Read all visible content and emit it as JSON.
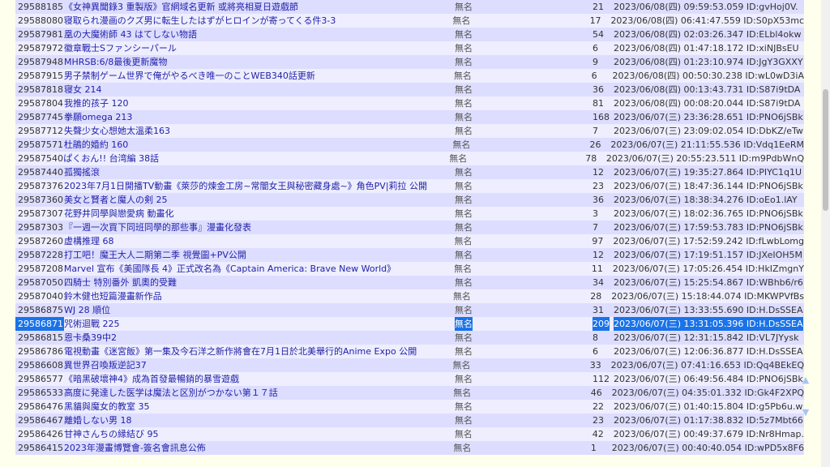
{
  "rows": [
    {
      "id": "29588185",
      "title": "《女神異聞錄3 重製版》官網域名更新 或將亮相夏日遊戲節",
      "author": "無名",
      "replies": "21",
      "time": "2023/06/08(四) 09:59:53.059 ID:gvHoj0V."
    },
    {
      "id": "29588080",
      "title": "寝取られ漫画のクズ男に転生したはずがヒロインが寄ってくる件3-3",
      "author": "無名",
      "replies": "17",
      "time": "2023/06/08(四) 06:41:47.559 ID:S0pX53mc"
    },
    {
      "id": "29587981",
      "title": "凰の大魔術師 43 はてしない物語",
      "author": "無名",
      "replies": "54",
      "time": "2023/06/08(四) 02:03:26.347 ID:ELbl4okw"
    },
    {
      "id": "29587972",
      "title": "徽章戰士Sファンシーパール",
      "author": "無名",
      "replies": "6",
      "time": "2023/06/08(四) 01:47:18.172 ID:xiNJBsEU"
    },
    {
      "id": "29587948",
      "title": "MHRSB:6/8最後更新魔物",
      "author": "無名",
      "replies": "9",
      "time": "2023/06/08(四) 01:23:10.974 ID:JgY3GXXY"
    },
    {
      "id": "29587915",
      "title": "男子禁制ゲーム世界で俺がやるべき唯一のことWEB340話更新",
      "author": "無名",
      "replies": "6",
      "time": "2023/06/08(四) 00:50:30.238 ID:wL0wD3iA"
    },
    {
      "id": "29587818",
      "title": "寝女 214",
      "author": "無名",
      "replies": "36",
      "time": "2023/06/08(四) 00:13:43.731 ID:S87i9tDA"
    },
    {
      "id": "29587804",
      "title": "我推的孩子 120",
      "author": "無名",
      "replies": "81",
      "time": "2023/06/08(四) 00:08:20.044 ID:S87i9tDA"
    },
    {
      "id": "29587745",
      "title": "拳願omega 213",
      "author": "無名",
      "replies": "168",
      "time": "2023/06/07(三) 23:36:28.651 ID:PNO6jSBk"
    },
    {
      "id": "29587712",
      "title": "失聲少女心想她太溫柔163",
      "author": "無名",
      "replies": "7",
      "time": "2023/06/07(三) 23:09:02.054 ID:DbKZ/eTw"
    },
    {
      "id": "29587571",
      "title": "杜鵑的婚約 160",
      "author": "無名",
      "replies": "26",
      "time": "2023/06/07(三) 21:11:55.536 ID:Vdq1EeRM"
    },
    {
      "id": "29587540",
      "title": "ぱくおん!! 台湾編 38話",
      "author": "無名",
      "replies": "78",
      "time": "2023/06/07(三) 20:55:23.511 ID:m9PdbWnQ"
    },
    {
      "id": "29587440",
      "title": "孤獨搖滾",
      "author": "無名",
      "replies": "12",
      "time": "2023/06/07(三) 19:35:27.864 ID:PIYC1q1U"
    },
    {
      "id": "29587376",
      "title": "2023年7月1日開播TV動畫《萊莎的煉金工房~常闇女王與秘密藏身處~》角色PV|莉拉 公開",
      "author": "無名",
      "replies": "23",
      "time": "2023/06/07(三) 18:47:36.144 ID:PNO6jSBk"
    },
    {
      "id": "29587360",
      "title": "美女と賢者と魔人の剣 25",
      "author": "無名",
      "replies": "36",
      "time": "2023/06/07(三) 18:38:34.276 ID:oEo1.lAY"
    },
    {
      "id": "29587307",
      "title": "花野井同學與戀愛病 動畫化",
      "author": "無名",
      "replies": "3",
      "time": "2023/06/07(三) 18:02:36.765 ID:PNO6jSBk"
    },
    {
      "id": "29587303",
      "title": "『一週一次買下同班同學的那些事』漫畫化發表",
      "author": "無名",
      "replies": "7",
      "time": "2023/06/07(三) 17:59:53.783 ID:PNO6jSBk"
    },
    {
      "id": "29587260",
      "title": "虚構推理 68",
      "author": "無名",
      "replies": "97",
      "time": "2023/06/07(三) 17:52:59.242 ID:fLwbLomg"
    },
    {
      "id": "29587228",
      "title": "打工吧！魔王大人二期第二季 視覺圖+PV公開",
      "author": "無名",
      "replies": "12",
      "time": "2023/06/07(三) 17:19:51.157 ID:JXeIOH5M"
    },
    {
      "id": "29587208",
      "title": "Marvel 宣布《美國隊長 4》正式改名為《Captain America: Brave New World》",
      "author": "無名",
      "replies": "11",
      "time": "2023/06/07(三) 17:05:26.454 ID:HkIZmgnY"
    },
    {
      "id": "29587050",
      "title": "四騎士 特別番外 凱奧的受難",
      "author": "無名",
      "replies": "34",
      "time": "2023/06/07(三) 15:25:54.867 ID:WBhb6/r6"
    },
    {
      "id": "29587040",
      "title": "鈴木健也短篇漫畫新作品",
      "author": "無名",
      "replies": "28",
      "time": "2023/06/07(三) 15:18:44.074 ID:MKWPVfBs"
    },
    {
      "id": "29586875",
      "title": "WJ 28 順位",
      "author": "無名",
      "replies": "31",
      "time": "2023/06/07(三) 13:33:55.690 ID:H.DsSSEA"
    },
    {
      "id": "29586871",
      "title": "咒術迴戰 225",
      "author": "無名",
      "replies": "209",
      "time": "2023/06/07(三) 13:31:05.396 ID:H.DsSSEA",
      "selected": true
    },
    {
      "id": "29586815",
      "title": "恩卡桑39中2",
      "author": "無名",
      "replies": "8",
      "time": "2023/06/07(三) 12:31:15.842 ID:VL7JYysk"
    },
    {
      "id": "29586786",
      "title": "電視動畫《迷宮飯》第一集及今石洋之新作將會在7月1日於北美舉行的Anime Expo 公開",
      "author": "無名",
      "replies": "6",
      "time": "2023/06/07(三) 12:06:36.877 ID:H.DsSSEA"
    },
    {
      "id": "29586608",
      "title": "異世界召喚叛逆記37",
      "author": "無名",
      "replies": "33",
      "time": "2023/06/07(三) 07:41:16.653 ID:Qq4BEkEQ"
    },
    {
      "id": "29586577",
      "title": "《暗黑破壞神4》成為首發最暢銷的暴雪遊戲",
      "author": "無名",
      "replies": "112",
      "time": "2023/06/07(三) 06:49:56.484 ID:PNO6jSBk"
    },
    {
      "id": "29586533",
      "title": "高度に発達した医学は魔法と区別がつかない第１７話",
      "author": "無名",
      "replies": "46",
      "time": "2023/06/07(三) 04:35:01.332 ID:Gk4F2XPQ"
    },
    {
      "id": "29586476",
      "title": "黑貓與魔女的教室 35",
      "author": "無名",
      "replies": "22",
      "time": "2023/06/07(三) 01:40:15.804 ID:g5Pb6u.w"
    },
    {
      "id": "29586467",
      "title": "離婚しない男 18",
      "author": "無名",
      "replies": "23",
      "time": "2023/06/07(三) 01:17:38.832 ID:5z7Mbt66"
    },
    {
      "id": "29586426",
      "title": "甘神さんちの縁結び 95",
      "author": "無名",
      "replies": "42",
      "time": "2023/06/07(三) 00:49:37.679 ID:Nr8Hmap."
    },
    {
      "id": "29586415",
      "title": "2023年漫畫博覽會-簽名會訊息公佈",
      "author": "無名",
      "replies": "1",
      "time": "2023/06/07(三) 00:40:40.054 ID:wPD5x8F6"
    }
  ],
  "scroll": {
    "up_icon": "▲",
    "down_icon": "▼"
  }
}
